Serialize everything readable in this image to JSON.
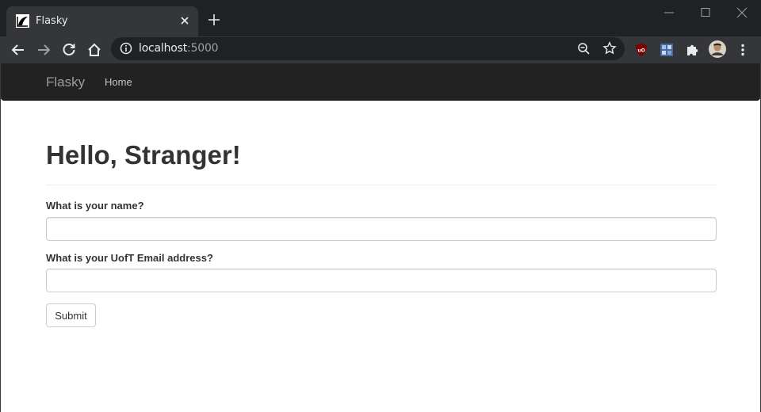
{
  "browser": {
    "tab": {
      "title": "Flasky",
      "favicon": "flask-logo-icon"
    },
    "address": {
      "host": "localhost",
      "port": ":5000"
    },
    "icons": [
      "back-arrow-icon",
      "forward-arrow-icon",
      "reload-icon",
      "home-icon",
      "info-icon",
      "zoom-icon",
      "star-icon",
      "ublock-icon",
      "extension-image-icon",
      "puzzle-icon",
      "profile-avatar",
      "menu-dots-icon"
    ]
  },
  "navbar": {
    "brand": "Flasky",
    "links": [
      {
        "label": "Home"
      }
    ]
  },
  "main": {
    "heading": "Hello, Stranger!",
    "form": {
      "name_label": "What is your name?",
      "name_value": "",
      "email_label": "What is your UofT Email address?",
      "email_value": "",
      "submit_label": "Submit"
    }
  },
  "colors": {
    "navbar_bg": "#222222",
    "navbar_text": "#9d9d9d",
    "chrome_bg": "#35363a",
    "tabstrip_bg": "#202124"
  }
}
